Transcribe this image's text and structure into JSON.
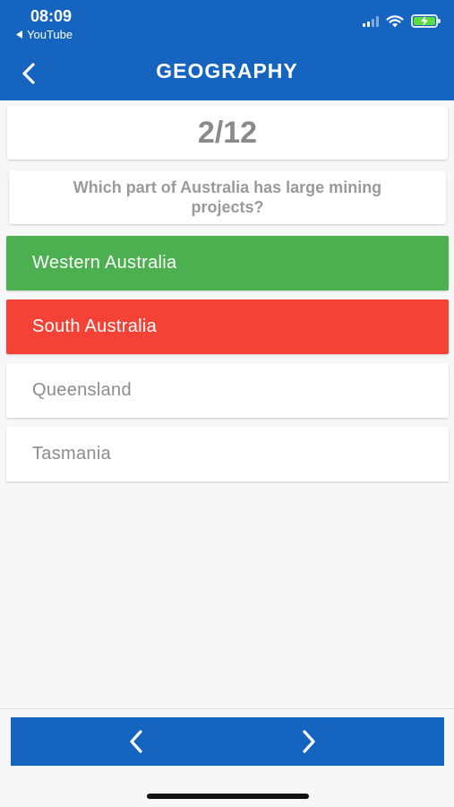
{
  "status_bar": {
    "time": "08:09",
    "back_app": "YouTube"
  },
  "header": {
    "title": "GEOGRAPHY"
  },
  "quiz": {
    "counter": "2/12",
    "question": "Which part of Australia has large mining projects?",
    "options": [
      {
        "label": "Western Australia",
        "state": "correct"
      },
      {
        "label": "South Australia",
        "state": "wrong"
      },
      {
        "label": "Queensland",
        "state": "unselected"
      },
      {
        "label": "Tasmania",
        "state": "unselected"
      }
    ]
  },
  "colors": {
    "primary": "#1565c0",
    "correct": "#4caf50",
    "wrong": "#f44336",
    "background": "#f7f7f7"
  },
  "icons": {
    "header_back": "chevron-left-icon",
    "prev": "chevron-left-icon",
    "next": "chevron-right-icon"
  }
}
